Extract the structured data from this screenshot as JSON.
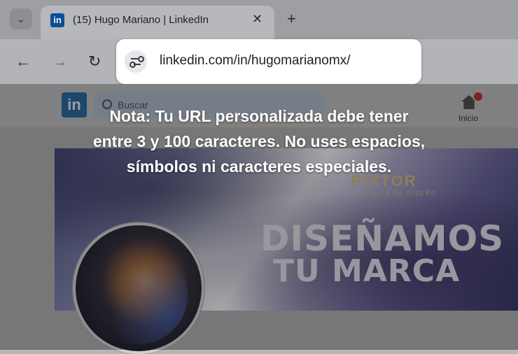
{
  "browser": {
    "tab_menu_icon": "chevron-down",
    "tab": {
      "favicon": "in",
      "title": "(15) Hugo Mariano | LinkedIn",
      "close_glyph": "✕"
    },
    "new_tab_glyph": "+",
    "nav": {
      "back": "←",
      "forward": "→",
      "reload": "↻"
    },
    "url": "linkedin.com/in/hugomarianomx/"
  },
  "linkedin": {
    "logo": "in",
    "search_placeholder": "Buscar",
    "home_label": "Inicio"
  },
  "banner": {
    "brand": "PIXTOR",
    "brand_sub": "AGENCIA DE DISEÑO",
    "line1": "DISEÑAMOS",
    "line2": "TU MARCA"
  },
  "note": {
    "line1": "Nota: Tu URL personalizada debe tener",
    "line2": "entre 3 y 100 caracteres. No uses espacios,",
    "line3": "símbolos ni caracteres especiales."
  },
  "colors": {
    "linkedin_blue": "#0a66c2",
    "notification_red": "#b3261e"
  }
}
